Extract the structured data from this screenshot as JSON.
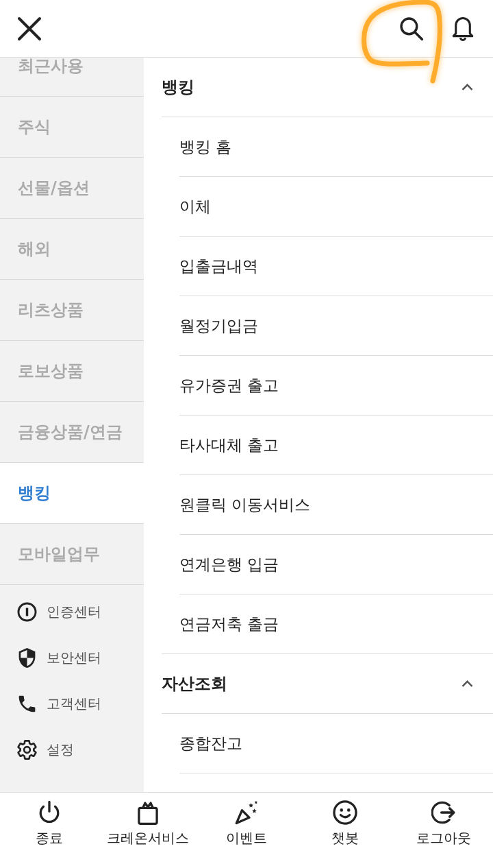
{
  "header": {
    "search_button": {
      "highlighted": true
    }
  },
  "sidebar": {
    "items": [
      {
        "label": "최근사용",
        "selected": false
      },
      {
        "label": "주식",
        "selected": false
      },
      {
        "label": "선물/옵션",
        "selected": false
      },
      {
        "label": "해외",
        "selected": false
      },
      {
        "label": "리츠상품",
        "selected": false
      },
      {
        "label": "로보상품",
        "selected": false
      },
      {
        "label": "금융상품/연금",
        "selected": false
      },
      {
        "label": "뱅킹",
        "selected": true
      },
      {
        "label": "모바일업무",
        "selected": false
      }
    ],
    "links": [
      {
        "label": "인증센터"
      },
      {
        "label": "보안센터"
      },
      {
        "label": "고객센터"
      },
      {
        "label": "설정"
      }
    ]
  },
  "menu": {
    "sections": [
      {
        "title": "뱅킹",
        "expanded": true,
        "items": [
          "뱅킹 홈",
          "이체",
          "입출금내역",
          "월정기입금",
          "유가증권 출고",
          "타사대체 출고",
          "원클릭 이동서비스",
          "연계은행 입금",
          "연금저축 출금"
        ]
      },
      {
        "title": "자산조회",
        "expanded": true,
        "items": [
          "종합잔고"
        ]
      }
    ]
  },
  "bottom_bar": [
    {
      "label": "종료"
    },
    {
      "label": "크레온서비스"
    },
    {
      "label": "이벤트"
    },
    {
      "label": "챗봇"
    },
    {
      "label": "로그아웃"
    }
  ]
}
